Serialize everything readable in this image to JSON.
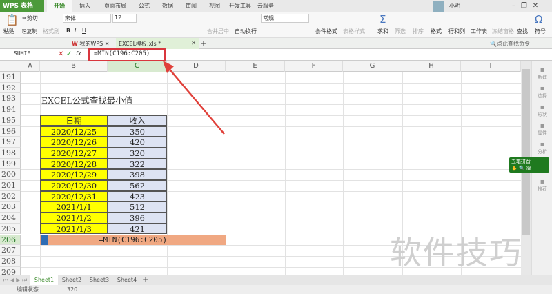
{
  "app": {
    "logo": "WPS 表格",
    "menu_tabs": [
      "开始",
      "插入",
      "页面布局",
      "公式",
      "数据",
      "审阅",
      "视图",
      "开发工具",
      "云服务"
    ],
    "active_tab": "开始",
    "user": "小明",
    "window_controls": [
      "minimize",
      "restore",
      "close"
    ]
  },
  "ribbon": {
    "paste": "粘贴",
    "cut": "剪切",
    "copy": "复制",
    "format_painter": "格式刷",
    "font_name": "宋体",
    "font_size": "12",
    "bold": "B",
    "italic": "I",
    "underline": "U",
    "merge": "合并居中",
    "wrap": "自动换行",
    "number_format": "常规",
    "cond_format": "条件格式",
    "table_style": "表格样式",
    "sum": "求和",
    "filter": "筛选",
    "sort": "排序",
    "format": "格式",
    "rowcol": "行和列",
    "worksheet": "工作表",
    "freeze": "冻结窗格",
    "find": "查找",
    "symbol": "符号",
    "search_cmd": "点此查找命令"
  },
  "doc_tabs": [
    {
      "label": "我的WPS"
    },
    {
      "label": "EXCEL模板.xls *"
    }
  ],
  "formula_bar": {
    "name_box": "SUMIF",
    "fx": "fx",
    "formula": "=MIN(C196:C205)"
  },
  "columns": [
    "A",
    "B",
    "C",
    "D",
    "E",
    "F",
    "G",
    "H",
    "I"
  ],
  "rows": [
    "191",
    "192",
    "193",
    "194",
    "195",
    "196",
    "197",
    "198",
    "199",
    "200",
    "201",
    "202",
    "203",
    "204",
    "205",
    "206",
    "207",
    "208",
    "209"
  ],
  "sheet": {
    "title": "EXCEL公式查找最小值",
    "headers": [
      "日期",
      "收入"
    ],
    "data": [
      [
        "2020/12/25",
        "350"
      ],
      [
        "2020/12/26",
        "420"
      ],
      [
        "2020/12/27",
        "320"
      ],
      [
        "2020/12/28",
        "322"
      ],
      [
        "2020/12/29",
        "398"
      ],
      [
        "2020/12/30",
        "562"
      ],
      [
        "2020/12/31",
        "423"
      ],
      [
        "2021/1/1",
        "512"
      ],
      [
        "2021/1/2",
        "396"
      ],
      [
        "2021/1/3",
        "421"
      ]
    ],
    "formula_cell": "=MIN(C196:C205)"
  },
  "sidebar": [
    "新建",
    "选择",
    "形状",
    "属性",
    "分析",
    "传图",
    "推荐"
  ],
  "ime": {
    "mode": "五笔拼音",
    "simp": "简"
  },
  "sheet_tabs": [
    "Sheet1",
    "Sheet2",
    "Sheet3",
    "Sheet4"
  ],
  "status": {
    "mode": "编辑状态",
    "value": "320"
  },
  "watermark": "软件技巧"
}
